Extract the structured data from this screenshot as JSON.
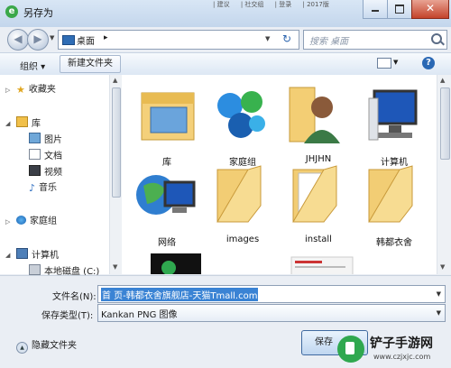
{
  "window": {
    "title": "另存为",
    "background_tabs": [
      "| 建议",
      "| 社交组",
      "| 登录",
      "| 2017版"
    ],
    "close_glyph": "✕"
  },
  "address_bar": {
    "location": "桌面",
    "separator": "▸"
  },
  "search": {
    "placeholder": "搜索 桌面"
  },
  "toolbar": {
    "organize": "组织 ▾",
    "new_folder": "新建文件夹"
  },
  "nav_pane": {
    "favorites": "收藏夹",
    "libraries": "库",
    "library_items": [
      "图片",
      "文档",
      "视频",
      "音乐"
    ],
    "homegroup": "家庭组",
    "computer": "计算机",
    "local_disk": "本地磁盘 (C:)"
  },
  "files": [
    {
      "name": "库",
      "icon": "library-icon"
    },
    {
      "name": "家庭组",
      "icon": "homegroup-icon"
    },
    {
      "name": "JHJHN",
      "icon": "user-icon"
    },
    {
      "name": "计算机",
      "icon": "computer-icon"
    },
    {
      "name": "网络",
      "icon": "network-icon"
    },
    {
      "name": "images",
      "icon": "folder-icon"
    },
    {
      "name": "install",
      "icon": "folder-icon"
    },
    {
      "name": "韩都衣舍",
      "icon": "folder-icon"
    }
  ],
  "form": {
    "filename_label": "文件名(N):",
    "filename_value": "首 页-韩都衣舍旗舰店-天猫Tmall.com",
    "filetype_label": "保存类型(T):",
    "filetype_value": "Kankan PNG 图像"
  },
  "hide_folders": "隐藏文件夹",
  "save_button": "保存",
  "watermark": {
    "title": "铲子手游网",
    "url": "www.czjxjc.com"
  }
}
